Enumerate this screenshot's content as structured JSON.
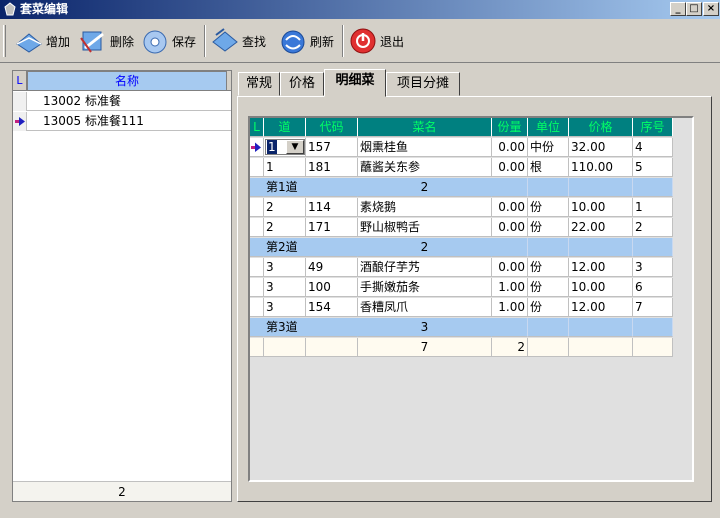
{
  "window": {
    "title": "套菜编辑",
    "controls": {
      "minimize": "_",
      "maximize": "□",
      "close": "×"
    }
  },
  "toolbar": {
    "add": "增加",
    "delete": "删除",
    "save": "保存",
    "find": "查找",
    "refresh": "刷新",
    "exit": "退出"
  },
  "left": {
    "header_l": "L",
    "header_name": "名称",
    "rows": [
      {
        "code": "13002",
        "name": "标准餐"
      },
      {
        "code": "13005",
        "name": "标准餐111"
      }
    ],
    "footer_count": "2"
  },
  "tabs": [
    "常规",
    "价格",
    "明细菜",
    "项目分摊"
  ],
  "grid": {
    "headers": [
      "L",
      "道",
      "代码",
      "菜名",
      "份量",
      "单位",
      "价格",
      "序号"
    ],
    "rows": [
      {
        "type": "item",
        "dao": "1",
        "code": "157",
        "name": "烟熏桂鱼",
        "qty": "0.00",
        "unit": "中份",
        "price": "32.00",
        "seq": "4"
      },
      {
        "type": "item",
        "dao": "1",
        "code": "181",
        "name": "蘸酱关东参",
        "qty": "0.00",
        "unit": "根",
        "price": "110.00",
        "seq": "5"
      },
      {
        "type": "sub",
        "label": "第1道",
        "count": "2"
      },
      {
        "type": "item",
        "dao": "2",
        "code": "114",
        "name": "素烧鹅",
        "qty": "0.00",
        "unit": "份",
        "price": "10.00",
        "seq": "1"
      },
      {
        "type": "item",
        "dao": "2",
        "code": "171",
        "name": "野山椒鸭舌",
        "qty": "0.00",
        "unit": "份",
        "price": "22.00",
        "seq": "2"
      },
      {
        "type": "sub",
        "label": "第2道",
        "count": "2"
      },
      {
        "type": "item",
        "dao": "3",
        "code": "49",
        "name": "酒酿仔芋艿",
        "qty": "0.00",
        "unit": "份",
        "price": "12.00",
        "seq": "3"
      },
      {
        "type": "item",
        "dao": "3",
        "code": "100",
        "name": "手撕嫩茄条",
        "qty": "1.00",
        "unit": "份",
        "price": "10.00",
        "seq": "6"
      },
      {
        "type": "item",
        "dao": "3",
        "code": "154",
        "name": "香糟凤爪",
        "qty": "1.00",
        "unit": "份",
        "price": "12.00",
        "seq": "7"
      },
      {
        "type": "sub",
        "label": "第3道",
        "count": "3"
      }
    ],
    "total": {
      "count": "7",
      "qty": "2"
    }
  }
}
